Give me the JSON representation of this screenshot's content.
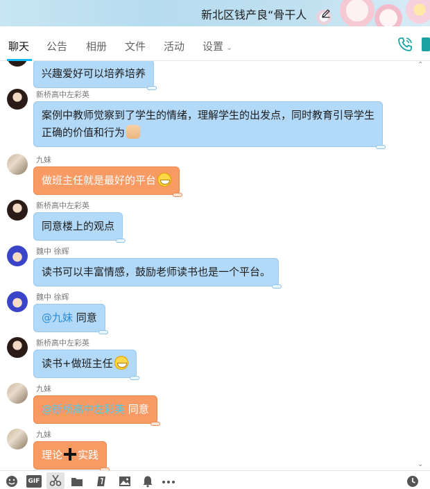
{
  "window": {
    "title": "新北区钱产良“骨干人"
  },
  "tabs": [
    {
      "label": "聊天",
      "active": true
    },
    {
      "label": "公告",
      "active": false
    },
    {
      "label": "相册",
      "active": false
    },
    {
      "label": "文件",
      "active": false
    },
    {
      "label": "活动",
      "active": false
    },
    {
      "label": "设置",
      "active": false
    }
  ],
  "icons": {
    "edit": "pencil-icon",
    "phone": "phone-icon",
    "settings_dropdown": "chevron-down-icon"
  },
  "colors": {
    "accent": "#12b7f5",
    "bubble_blue": "#b2d9f7",
    "bubble_orange": "#f79a63",
    "mention_blue": "#2a8ad4",
    "mention_on_orange": "#4ec9ee"
  },
  "messages": [
    {
      "sender": "",
      "text": "兴趣爱好可以培养培养",
      "style": "blue"
    },
    {
      "sender": "新桥高中左彩英",
      "line1": "案例中教师觉察到了学生的情绪，理解学生的出发点，同时教育引导学生",
      "line2": "正确的价值和行为",
      "emoji": "thumbs-up-icon",
      "style": "blue"
    },
    {
      "sender": "九妹",
      "text": "做班主任就是最好的平台",
      "emoji": "grin-emoji-icon",
      "style": "orange"
    },
    {
      "sender": "新桥高中左彩英",
      "text": "同意楼上的观点",
      "style": "blue"
    },
    {
      "sender": "魏中 徐辉",
      "text": "读书可以丰富情感，鼓励老师读书也是一个平台。",
      "style": "blue"
    },
    {
      "sender": "魏中 徐辉",
      "mention": "@九妹",
      "text": " 同意",
      "style": "blue"
    },
    {
      "sender": "新桥高中左彩英",
      "text": "读书+做班主任",
      "emoji": "grin-emoji-icon",
      "style": "blue"
    },
    {
      "sender": "九妹",
      "mention": "@新桥高中左彩英",
      "text": " 同意",
      "style": "orange"
    },
    {
      "sender": "九妹",
      "text_a": "理论",
      "text_b": "实践",
      "emoji": "plus-icon",
      "style": "orange"
    }
  ],
  "toolbar": {
    "items": [
      "smiley-icon",
      "gif-icon",
      "scissors-icon",
      "folder-icon",
      "music-icon",
      "image-icon",
      "bell-icon",
      "more-icon",
      "history-clock-icon"
    ],
    "gif_label": "GIF"
  }
}
